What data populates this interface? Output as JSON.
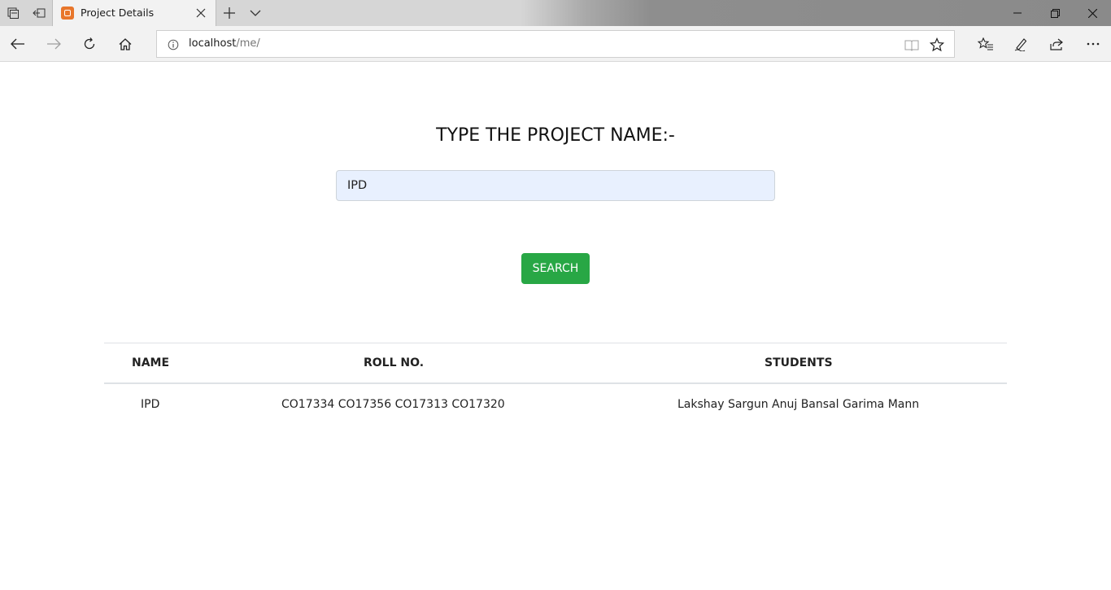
{
  "browser": {
    "tab_title": "Project Details",
    "url_host": "localhost",
    "url_path": "/me/"
  },
  "page": {
    "heading": "TYPE THE PROJECT NAME:-",
    "search_value": "IPD",
    "search_button": "SEARCH"
  },
  "table": {
    "headers": [
      "NAME",
      "ROLL NO.",
      "STUDENTS"
    ],
    "rows": [
      {
        "name": "IPD",
        "roll": "CO17334 CO17356 CO17313 CO17320",
        "students": "Lakshay Sargun Anuj Bansal Garima Mann"
      }
    ]
  },
  "colors": {
    "accent": "#28a745",
    "input_fill": "#e8f0fe",
    "favicon": "#e8762b"
  }
}
